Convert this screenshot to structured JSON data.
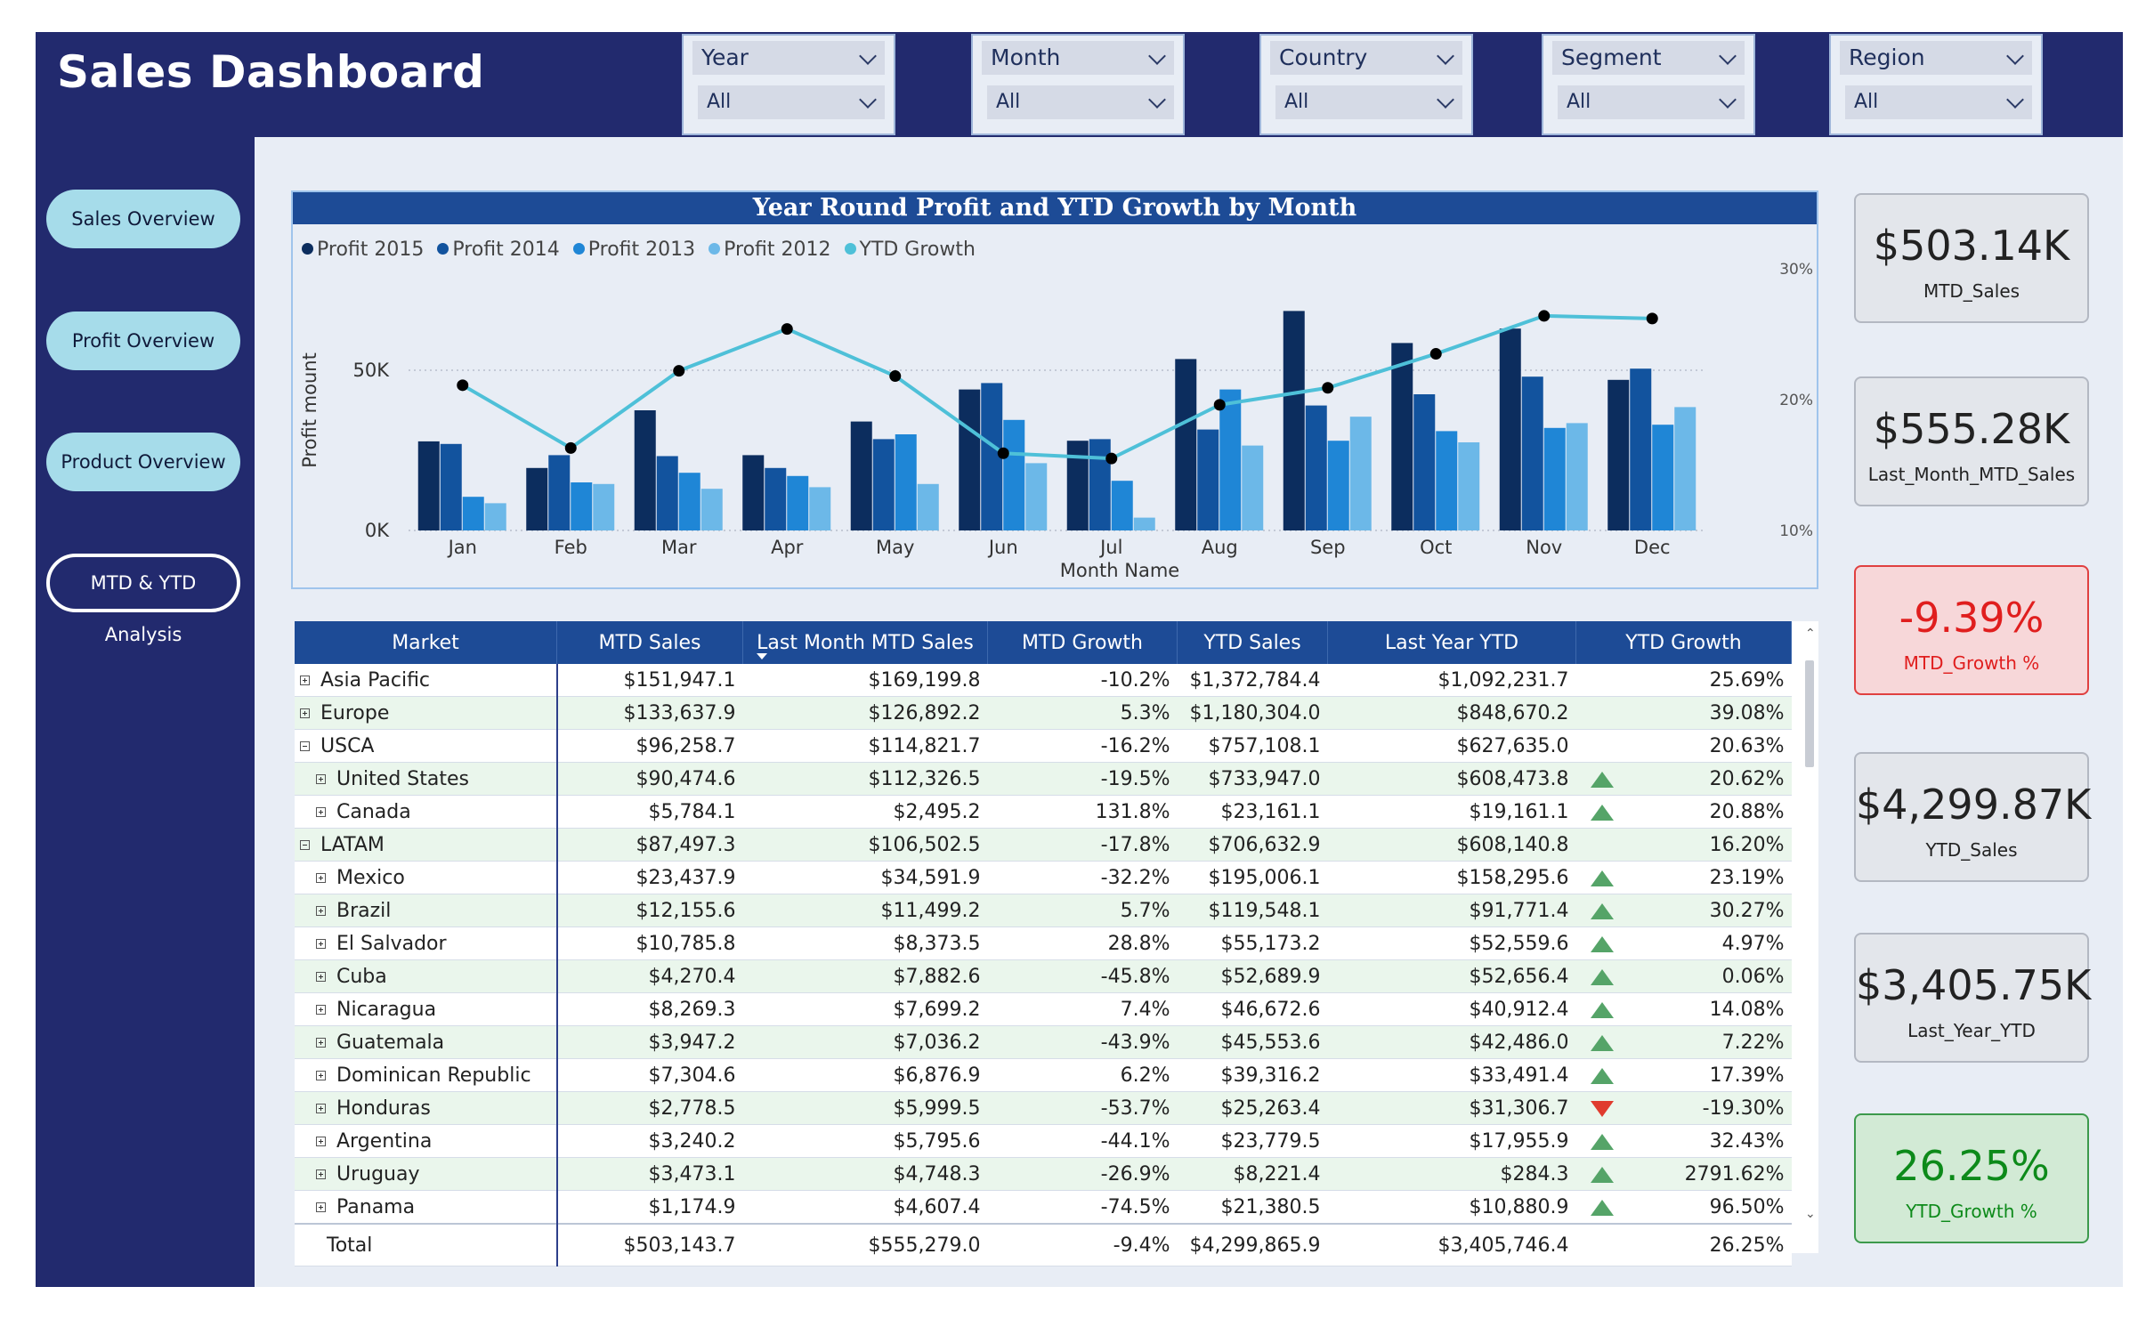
{
  "app": {
    "title": "Sales Dashboard"
  },
  "filters": [
    {
      "label": "Year",
      "value": "All"
    },
    {
      "label": "Month",
      "value": "All"
    },
    {
      "label": "Country",
      "value": "All"
    },
    {
      "label": "Segment",
      "value": "All"
    },
    {
      "label": "Region",
      "value": "All"
    }
  ],
  "nav": [
    {
      "label": "Sales Overview",
      "active": false
    },
    {
      "label": "Profit Overview",
      "active": false
    },
    {
      "label": "Product Overview",
      "active": false
    },
    {
      "label": "MTD & YTD Analysis",
      "active": true
    }
  ],
  "chart_data": {
    "type": "bar",
    "title": "Year Round Profit and YTD Growth by Month",
    "xlabel": "Month Name",
    "ylabel": "Profit mount",
    "y2label": "YTD Growth",
    "categories": [
      "Jan",
      "Feb",
      "Mar",
      "Apr",
      "May",
      "Jun",
      "Jul",
      "Aug",
      "Sep",
      "Oct",
      "Nov",
      "Dec"
    ],
    "ylim": [
      0,
      75000
    ],
    "y_ticks": [
      {
        "v": 0,
        "label": "0K"
      },
      {
        "v": 50000,
        "label": "50K"
      }
    ],
    "y2lim": [
      0.1,
      0.3
    ],
    "y2_ticks": [
      {
        "v": 0.1,
        "label": "10%"
      },
      {
        "v": 0.2,
        "label": "20%"
      },
      {
        "v": 0.3,
        "label": "30%"
      }
    ],
    "series": [
      {
        "name": "Profit 2015",
        "color": "#0c2d5e",
        "values": [
          27800,
          19500,
          37500,
          23500,
          34000,
          44000,
          28000,
          53500,
          68500,
          58500,
          63000,
          47000
        ]
      },
      {
        "name": "Profit 2014",
        "color": "#12539e",
        "values": [
          27000,
          23500,
          23200,
          19500,
          28500,
          46000,
          28500,
          31500,
          39000,
          42500,
          48000,
          50500
        ]
      },
      {
        "name": "Profit 2013",
        "color": "#1f86d6",
        "values": [
          10500,
          15000,
          18000,
          17000,
          30000,
          34500,
          15500,
          44000,
          28000,
          31000,
          32000,
          33000
        ]
      },
      {
        "name": "Profit 2012",
        "color": "#6cb8e8",
        "values": [
          8500,
          14500,
          13000,
          13500,
          14500,
          21000,
          4000,
          26500,
          35500,
          27500,
          33500,
          38500
        ]
      },
      {
        "name": "YTD Growth",
        "color": "#4ec0d8",
        "line": true,
        "values": [
          0.211,
          0.163,
          0.222,
          0.254,
          0.218,
          0.159,
          0.155,
          0.196,
          0.209,
          0.235,
          0.264,
          0.262
        ]
      }
    ],
    "legend_position": "top-left",
    "grid": true
  },
  "table": {
    "columns": [
      "Market",
      "MTD Sales",
      "Last Month MTD Sales",
      "MTD Growth",
      "YTD Sales",
      "Last Year YTD",
      "YTD Growth"
    ],
    "rows": [
      {
        "market": "Asia Pacific",
        "level": 0,
        "expand": "plus",
        "mtd": "$151,947.1",
        "lm": "$169,199.8",
        "mg": "-10.2%",
        "ytd": "$1,372,784.4",
        "ly": "$1,092,231.7",
        "yg": "25.69%",
        "icon": ""
      },
      {
        "market": "Europe",
        "level": 0,
        "expand": "plus",
        "mtd": "$133,637.9",
        "lm": "$126,892.2",
        "mg": "5.3%",
        "ytd": "$1,180,304.0",
        "ly": "$848,670.2",
        "yg": "39.08%",
        "icon": ""
      },
      {
        "market": "USCA",
        "level": 0,
        "expand": "minus",
        "mtd": "$96,258.7",
        "lm": "$114,821.7",
        "mg": "-16.2%",
        "ytd": "$757,108.1",
        "ly": "$627,635.0",
        "yg": "20.63%",
        "icon": ""
      },
      {
        "market": "United States",
        "level": 1,
        "expand": "plus",
        "mtd": "$90,474.6",
        "lm": "$112,326.5",
        "mg": "-19.5%",
        "ytd": "$733,947.0",
        "ly": "$608,473.8",
        "yg": "20.62%",
        "icon": "up"
      },
      {
        "market": "Canada",
        "level": 1,
        "expand": "plus",
        "mtd": "$5,784.1",
        "lm": "$2,495.2",
        "mg": "131.8%",
        "ytd": "$23,161.1",
        "ly": "$19,161.1",
        "yg": "20.88%",
        "icon": "up"
      },
      {
        "market": "LATAM",
        "level": 0,
        "expand": "minus",
        "mtd": "$87,497.3",
        "lm": "$106,502.5",
        "mg": "-17.8%",
        "ytd": "$706,632.9",
        "ly": "$608,140.8",
        "yg": "16.20%",
        "icon": ""
      },
      {
        "market": "Mexico",
        "level": 1,
        "expand": "plus",
        "mtd": "$23,437.9",
        "lm": "$34,591.9",
        "mg": "-32.2%",
        "ytd": "$195,006.1",
        "ly": "$158,295.6",
        "yg": "23.19%",
        "icon": "up"
      },
      {
        "market": "Brazil",
        "level": 1,
        "expand": "plus",
        "mtd": "$12,155.6",
        "lm": "$11,499.2",
        "mg": "5.7%",
        "ytd": "$119,548.1",
        "ly": "$91,771.4",
        "yg": "30.27%",
        "icon": "up"
      },
      {
        "market": "El Salvador",
        "level": 1,
        "expand": "plus",
        "mtd": "$10,785.8",
        "lm": "$8,373.5",
        "mg": "28.8%",
        "ytd": "$55,173.2",
        "ly": "$52,559.6",
        "yg": "4.97%",
        "icon": "up"
      },
      {
        "market": "Cuba",
        "level": 1,
        "expand": "plus",
        "mtd": "$4,270.4",
        "lm": "$7,882.6",
        "mg": "-45.8%",
        "ytd": "$52,689.9",
        "ly": "$52,656.4",
        "yg": "0.06%",
        "icon": "up"
      },
      {
        "market": "Nicaragua",
        "level": 1,
        "expand": "plus",
        "mtd": "$8,269.3",
        "lm": "$7,699.2",
        "mg": "7.4%",
        "ytd": "$46,672.6",
        "ly": "$40,912.4",
        "yg": "14.08%",
        "icon": "up"
      },
      {
        "market": "Guatemala",
        "level": 1,
        "expand": "plus",
        "mtd": "$3,947.2",
        "lm": "$7,036.2",
        "mg": "-43.9%",
        "ytd": "$45,553.6",
        "ly": "$42,486.0",
        "yg": "7.22%",
        "icon": "up"
      },
      {
        "market": "Dominican Republic",
        "level": 1,
        "expand": "plus",
        "mtd": "$7,304.6",
        "lm": "$6,876.9",
        "mg": "6.2%",
        "ytd": "$39,316.2",
        "ly": "$33,491.4",
        "yg": "17.39%",
        "icon": "up"
      },
      {
        "market": "Honduras",
        "level": 1,
        "expand": "plus",
        "mtd": "$2,778.5",
        "lm": "$5,999.5",
        "mg": "-53.7%",
        "ytd": "$25,263.4",
        "ly": "$31,306.7",
        "yg": "-19.30%",
        "icon": "down"
      },
      {
        "market": "Argentina",
        "level": 1,
        "expand": "plus",
        "mtd": "$3,240.2",
        "lm": "$5,795.6",
        "mg": "-44.1%",
        "ytd": "$23,779.5",
        "ly": "$17,955.9",
        "yg": "32.43%",
        "icon": "up"
      },
      {
        "market": "Uruguay",
        "level": 1,
        "expand": "plus",
        "mtd": "$3,473.1",
        "lm": "$4,748.3",
        "mg": "-26.9%",
        "ytd": "$8,221.4",
        "ly": "$284.3",
        "yg": "2791.62%",
        "icon": "up"
      },
      {
        "market": "Panama",
        "level": 1,
        "expand": "plus",
        "mtd": "$1,174.9",
        "lm": "$4,607.4",
        "mg": "-74.5%",
        "ytd": "$21,380.5",
        "ly": "$10,880.9",
        "yg": "96.50%",
        "icon": "up"
      }
    ],
    "total": {
      "market": "Total",
      "mtd": "$503,143.7",
      "lm": "$555,279.0",
      "mg": "-9.4%",
      "ytd": "$4,299,865.9",
      "ly": "$3,405,746.4",
      "yg": "26.25%"
    }
  },
  "kpis": [
    {
      "value": "$503.14K",
      "label": "MTD_Sales",
      "style": "neutral"
    },
    {
      "value": "$555.28K",
      "label": "Last_Month_MTD_Sales",
      "style": "neutral"
    },
    {
      "value": "-9.39%",
      "label": "MTD_Growth %",
      "style": "red"
    },
    {
      "value": "$4,299.87K",
      "label": "YTD_Sales",
      "style": "neutral"
    },
    {
      "value": "$3,405.75K",
      "label": "Last_Year_YTD",
      "style": "neutral"
    },
    {
      "value": "26.25%",
      "label": "YTD_Growth %",
      "style": "green"
    }
  ],
  "colors": {
    "header": "#222a6e",
    "nav_button": "#a6dcea",
    "table_header": "#1d4b96",
    "kpi_red": "#e01e1e",
    "kpi_green": "#0d8a1a"
  }
}
